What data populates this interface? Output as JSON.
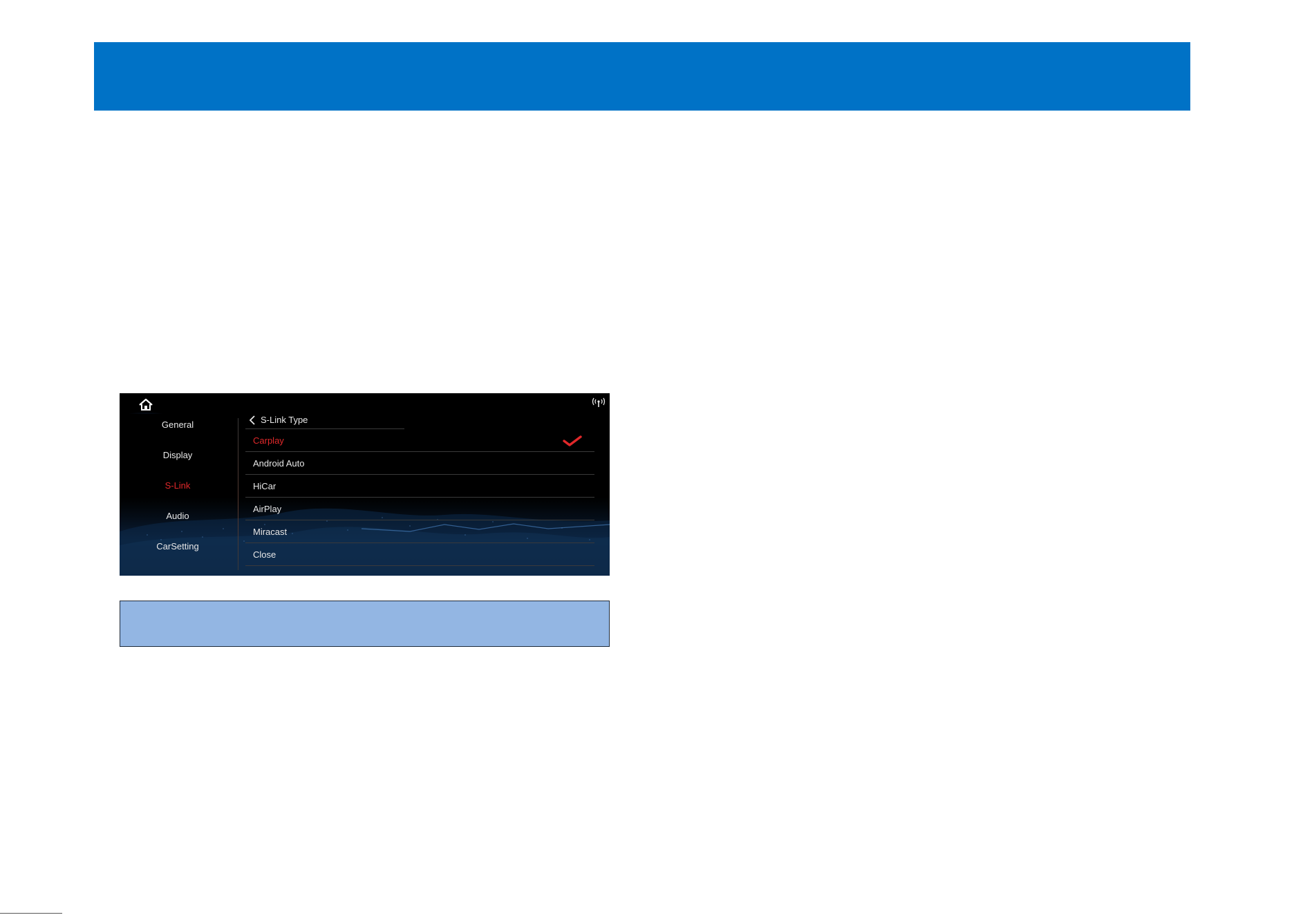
{
  "sidebar": {
    "items": [
      {
        "label": "General"
      },
      {
        "label": "Display"
      },
      {
        "label": "S-Link"
      },
      {
        "label": "Audio"
      },
      {
        "label": "CarSetting"
      }
    ]
  },
  "panel": {
    "title": "S-Link Type",
    "options": [
      {
        "label": "Carplay"
      },
      {
        "label": "Android Auto"
      },
      {
        "label": "HiCar"
      },
      {
        "label": "AirPlay"
      },
      {
        "label": "Miracast"
      },
      {
        "label": "Close"
      }
    ]
  },
  "colors": {
    "header_band": "#0072c6",
    "accent_active": "#e0282a",
    "caption_box": "#93b6e3"
  },
  "icons": {
    "home": "home-icon",
    "signal": "antenna-icon",
    "back": "chevron-left-icon",
    "selected": "checkmark-icon"
  }
}
